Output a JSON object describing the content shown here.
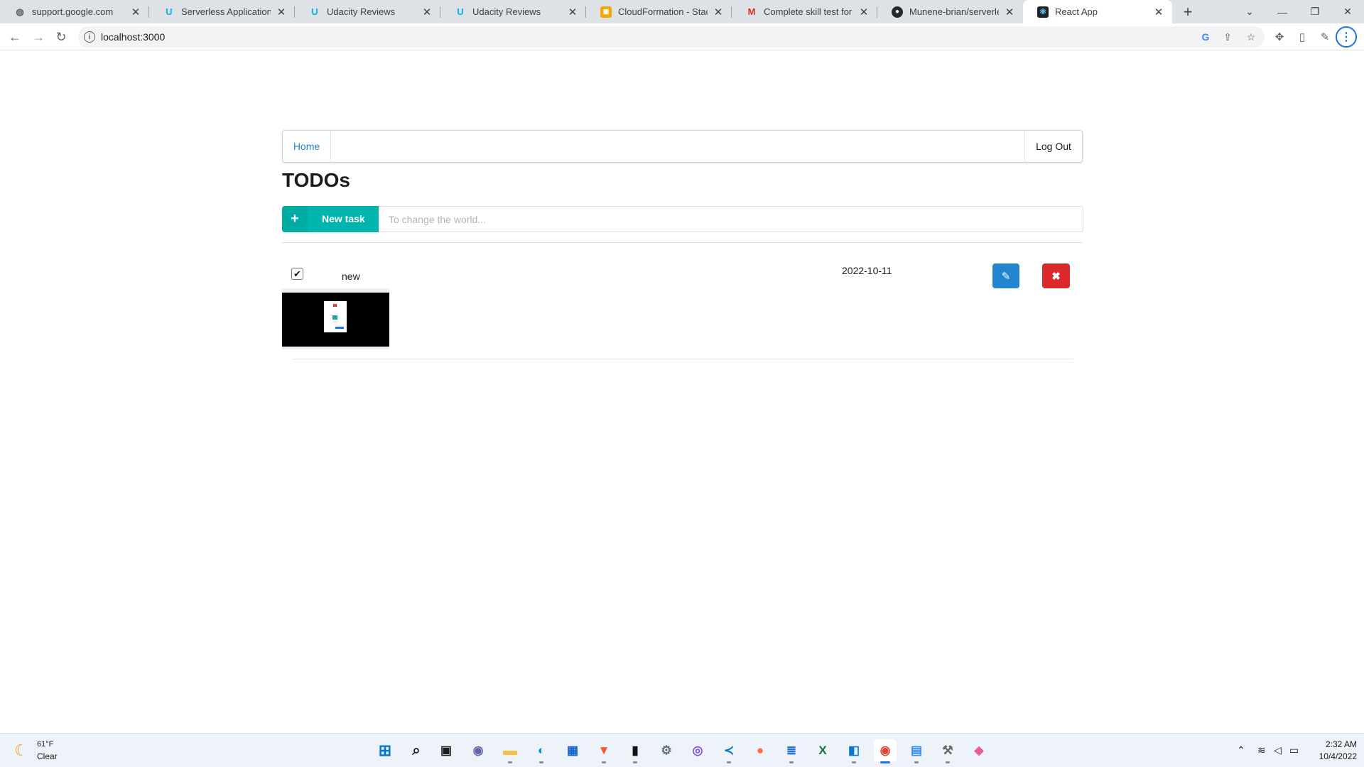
{
  "browser": {
    "tabs": [
      {
        "title": "support.google.com",
        "favicon": "globe-icon",
        "favicon_color": "#5f6368"
      },
      {
        "title": "Serverless Application - Udacity",
        "favicon": "udacity-icon",
        "favicon_color": "#02b3e4"
      },
      {
        "title": "Udacity Reviews",
        "favicon": "udacity-icon",
        "favicon_color": "#02b3e4"
      },
      {
        "title": "Udacity Reviews",
        "favicon": "udacity-icon",
        "favicon_color": "#02b3e4"
      },
      {
        "title": "CloudFormation - Stack se",
        "favicon": "aws-cube-icon",
        "favicon_color": "#f2a900"
      },
      {
        "title": "Complete skill test for Geb",
        "favicon": "gmail-icon",
        "favicon_color": "#d93025"
      },
      {
        "title": "Munene-brian/serverless",
        "favicon": "github-icon",
        "favicon_color": "#24292f"
      },
      {
        "title": "React App",
        "favicon": "react-icon",
        "favicon_color": "#61dafb",
        "active": true
      }
    ],
    "address": "localhost:3000"
  },
  "app": {
    "menu": {
      "home": "Home",
      "logout": "Log Out"
    },
    "title": "TODOs",
    "new_task": {
      "button_label": "New task",
      "placeholder": "To change the world..."
    },
    "todos": [
      {
        "name": "new",
        "due_date": "2022-10-11",
        "done": true,
        "has_attachment": true
      }
    ]
  },
  "colors": {
    "link": "#2185d0",
    "teal": "#00b5ad",
    "edit": "#2185d0",
    "delete": "#db2828"
  },
  "taskbar": {
    "weather": {
      "temp": "61°F",
      "condition": "Clear",
      "icon": "moon-icon"
    },
    "apps": [
      "windows-start-icon",
      "search-icon",
      "task-view-icon",
      "teams-chat-icon",
      "file-explorer-icon",
      "edge-icon",
      "store-icon",
      "brave-icon",
      "terminal-icon",
      "settings-icon",
      "github-desktop-icon",
      "vscode-icon",
      "postman-icon",
      "notepad-icon",
      "excel-icon",
      "remote-desktop-icon",
      "chrome-icon",
      "control-panel-icon",
      "tools-icon",
      "git-icon"
    ],
    "clock": {
      "time": "2:32 AM",
      "date": "10/4/2022"
    }
  }
}
